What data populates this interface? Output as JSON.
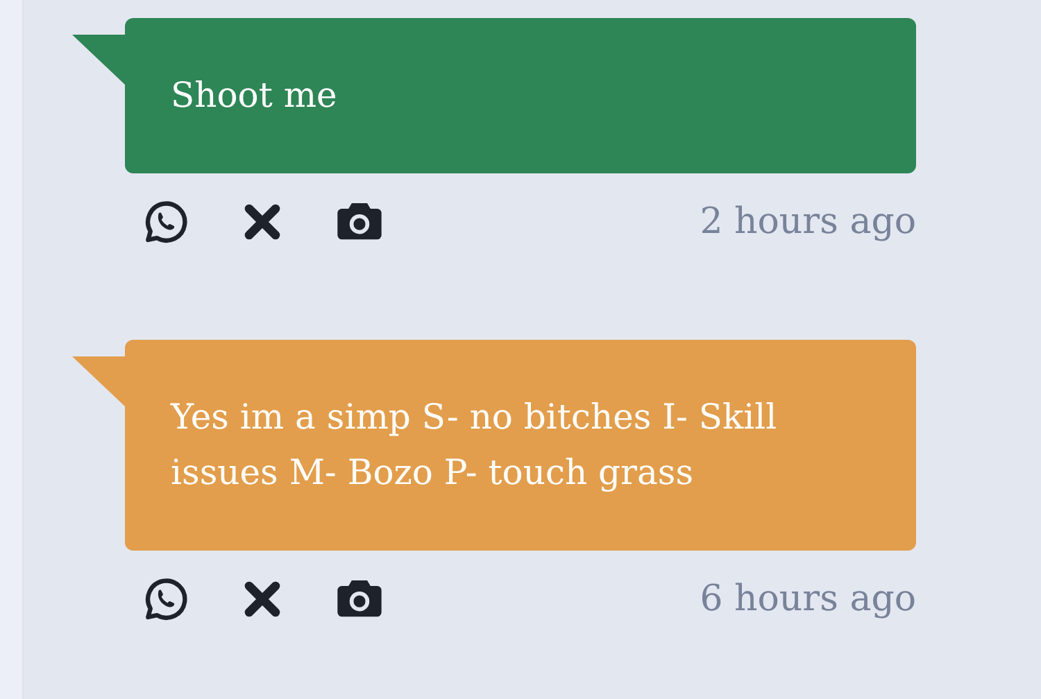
{
  "posts": [
    {
      "text": "Shoot me",
      "color": "#2e8555",
      "time": "2 hours ago"
    },
    {
      "text": "Yes im a simp S- no bitches I- Skill issues M- Bozo P- touch grass",
      "color": "#e29e4c",
      "time": "6 hours ago"
    }
  ]
}
